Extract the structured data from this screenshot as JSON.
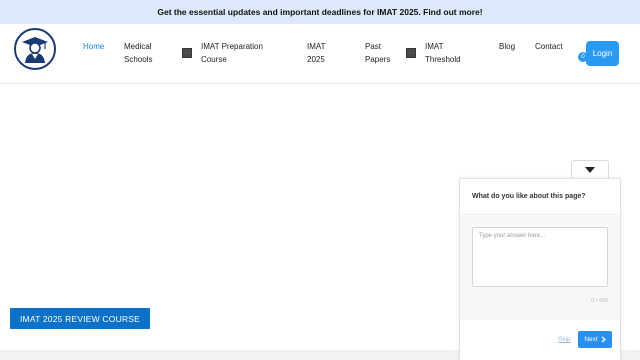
{
  "announcement": {
    "text": "Get the essential updates and important deadlines for IMAT 2025. Find out more!"
  },
  "header": {
    "logo_icon": "graduate-cap-logo-icon",
    "nav": [
      {
        "label_line1": "Home",
        "label_line2": "",
        "active": true,
        "has_icon": false
      },
      {
        "label_line1": "Medical",
        "label_line2": "Schools",
        "active": false,
        "has_icon": false
      },
      {
        "label_line1": "IMAT Preparation",
        "label_line2": "Course",
        "active": false,
        "has_icon": true
      },
      {
        "label_line1": "IMAT",
        "label_line2": "2025",
        "active": false,
        "has_icon": false
      },
      {
        "label_line1": "Past",
        "label_line2": "Papers",
        "active": false,
        "has_icon": false
      },
      {
        "label_line1": "IMAT",
        "label_line2": "Threshold",
        "active": false,
        "has_icon": true
      },
      {
        "label_line1": "Blog",
        "label_line2": "",
        "active": false,
        "has_icon": false
      },
      {
        "label_line1": "Contact",
        "label_line2": "",
        "active": false,
        "has_icon": false
      }
    ],
    "cart_count": "0",
    "login_label": "Login"
  },
  "main": {
    "cta_label": "IMAT 2025 REVIEW COURSE"
  },
  "survey": {
    "toggle_icon": "caret-down-icon",
    "question": "What do you like about this page?",
    "placeholder": "Type your answer here...",
    "char_count": "0 / 400",
    "skip_label": "Skip",
    "next_label": "Next",
    "next_icon": "chevron-right-icon"
  },
  "colors": {
    "announcement_bg": "#dbe9fb",
    "accent": "#2a9af0",
    "cta": "#0d72c7",
    "active_nav": "#1585d8",
    "logo_navy": "#1b3a73"
  }
}
